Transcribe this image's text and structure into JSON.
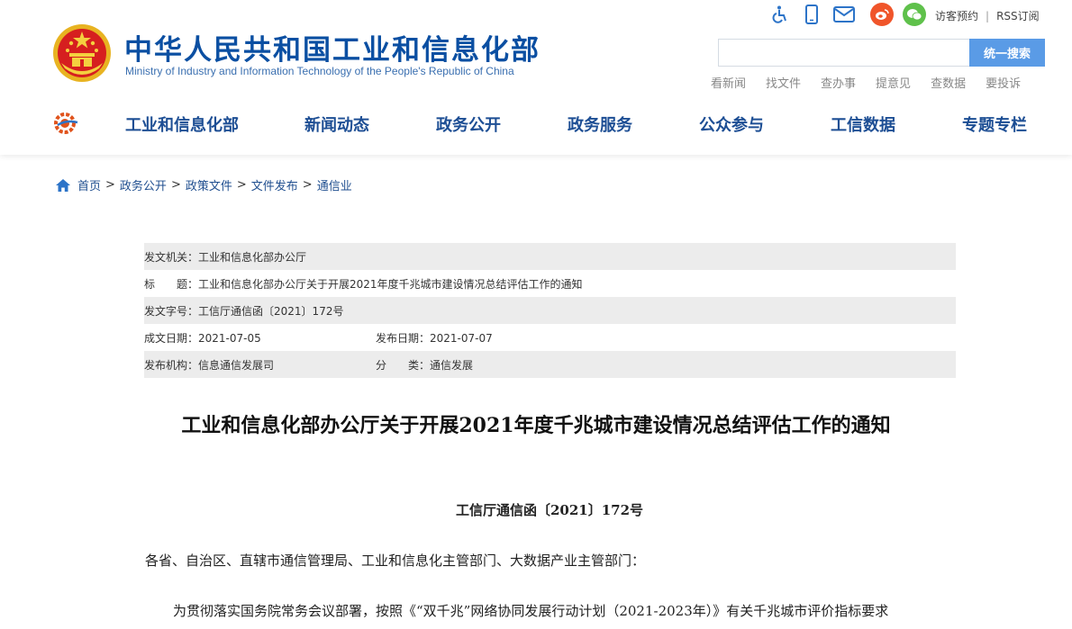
{
  "header": {
    "title": "中华人民共和国工业和信息化部",
    "subtitle": "Ministry of Industry and Information Technology of the People's Republic of China",
    "top_links": [
      "访客预约",
      "RSS订阅"
    ],
    "search_placeholder": "",
    "search_button": "统一搜索",
    "quick_links": [
      "看新闻",
      "找文件",
      "查办事",
      "提意见",
      "查数据",
      "要投诉"
    ]
  },
  "nav": {
    "items": [
      "工业和信息化部",
      "新闻动态",
      "政务公开",
      "政务服务",
      "公众参与",
      "工信数据",
      "专题专栏"
    ]
  },
  "breadcrumb": {
    "items": [
      "首页",
      "政务公开",
      "政策文件",
      "文件发布",
      "通信业"
    ]
  },
  "meta": {
    "issuer_label": "发文机关：",
    "issuer": "工业和信息化部办公厅",
    "title_label": "标　　题：",
    "title": "工业和信息化部办公厅关于开展2021年度千兆城市建设情况总结评估工作的通知",
    "doc_no_label": "发文字号：",
    "doc_no": "工信厅通信函〔2021〕172号",
    "created_label": "成文日期：",
    "created": "2021-07-05",
    "published_label": "发布日期：",
    "published": "2021-07-07",
    "org_label": "发布机构：",
    "org": "信息通信发展司",
    "category_label": "分　　类：",
    "category": "通信发展"
  },
  "article": {
    "title": "工业和信息化部办公厅关于开展2021年度千兆城市建设情况总结评估工作的通知",
    "doc_no": "工信厅通信函〔2021〕172号",
    "salutation": "各省、自治区、直辖市通信管理局、工业和信息化主管部门、大数据产业主管部门：",
    "para1": "为贯彻落实国务院常务会议部署，按照《“双千兆”网络协同发展行动计划（2021-2023年）》有关千兆城市评价指标要求"
  },
  "colors": {
    "brand_blue": "#0b4fa2",
    "nav_blue": "#1d4e94",
    "search_button": "#5a9be6",
    "weibo": "#f0552a",
    "wechat": "#5fc14b"
  },
  "icons": [
    "accessibility-icon",
    "mobile-icon",
    "mail-icon",
    "weibo-icon",
    "wechat-icon",
    "home-icon",
    "national-emblem",
    "miit-logo-icon"
  ]
}
